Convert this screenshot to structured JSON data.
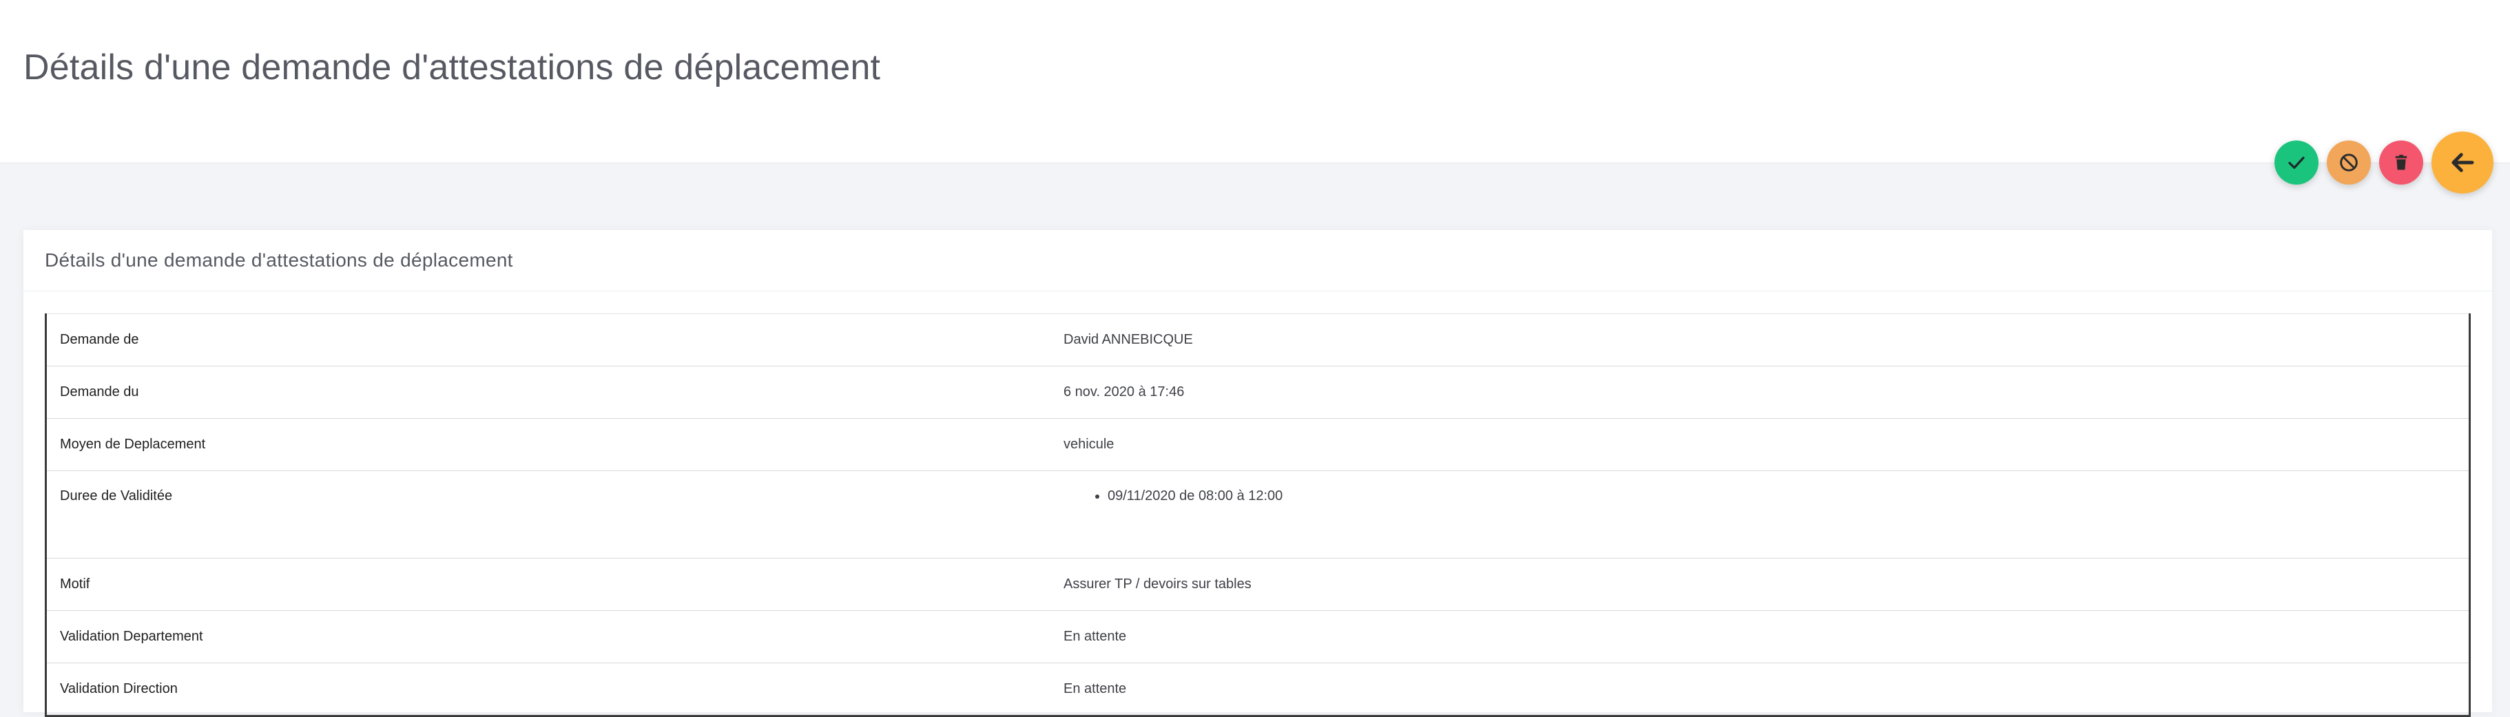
{
  "header": {
    "title": "Détails d'une demande d'attestations de déplacement"
  },
  "actions": {
    "validate_icon": "check-icon",
    "refuse_icon": "ban-icon",
    "delete_icon": "trash-icon",
    "back_icon": "arrow-left-icon",
    "colors": {
      "validate": "#1bc47d",
      "refuse": "#f2a65a",
      "delete": "#f3566d",
      "back": "#fbb13c"
    }
  },
  "card": {
    "title": "Détails d'une demande d'attestations de déplacement",
    "rows": [
      {
        "label": "Demande de",
        "value": "David ANNEBICQUE"
      },
      {
        "label": "Demande du",
        "value": "6 nov. 2020 à 17:46"
      },
      {
        "label": "Moyen de Deplacement",
        "value": "vehicule"
      },
      {
        "label": "Duree de Validitée",
        "items": [
          "09/11/2020 de 08:00 à 12:00"
        ]
      },
      {
        "label": "Motif",
        "value": "Assurer TP / devoirs sur tables"
      },
      {
        "label": "Validation Departement",
        "value": "En attente"
      },
      {
        "label": "Validation Direction",
        "value": "En attente"
      }
    ]
  }
}
